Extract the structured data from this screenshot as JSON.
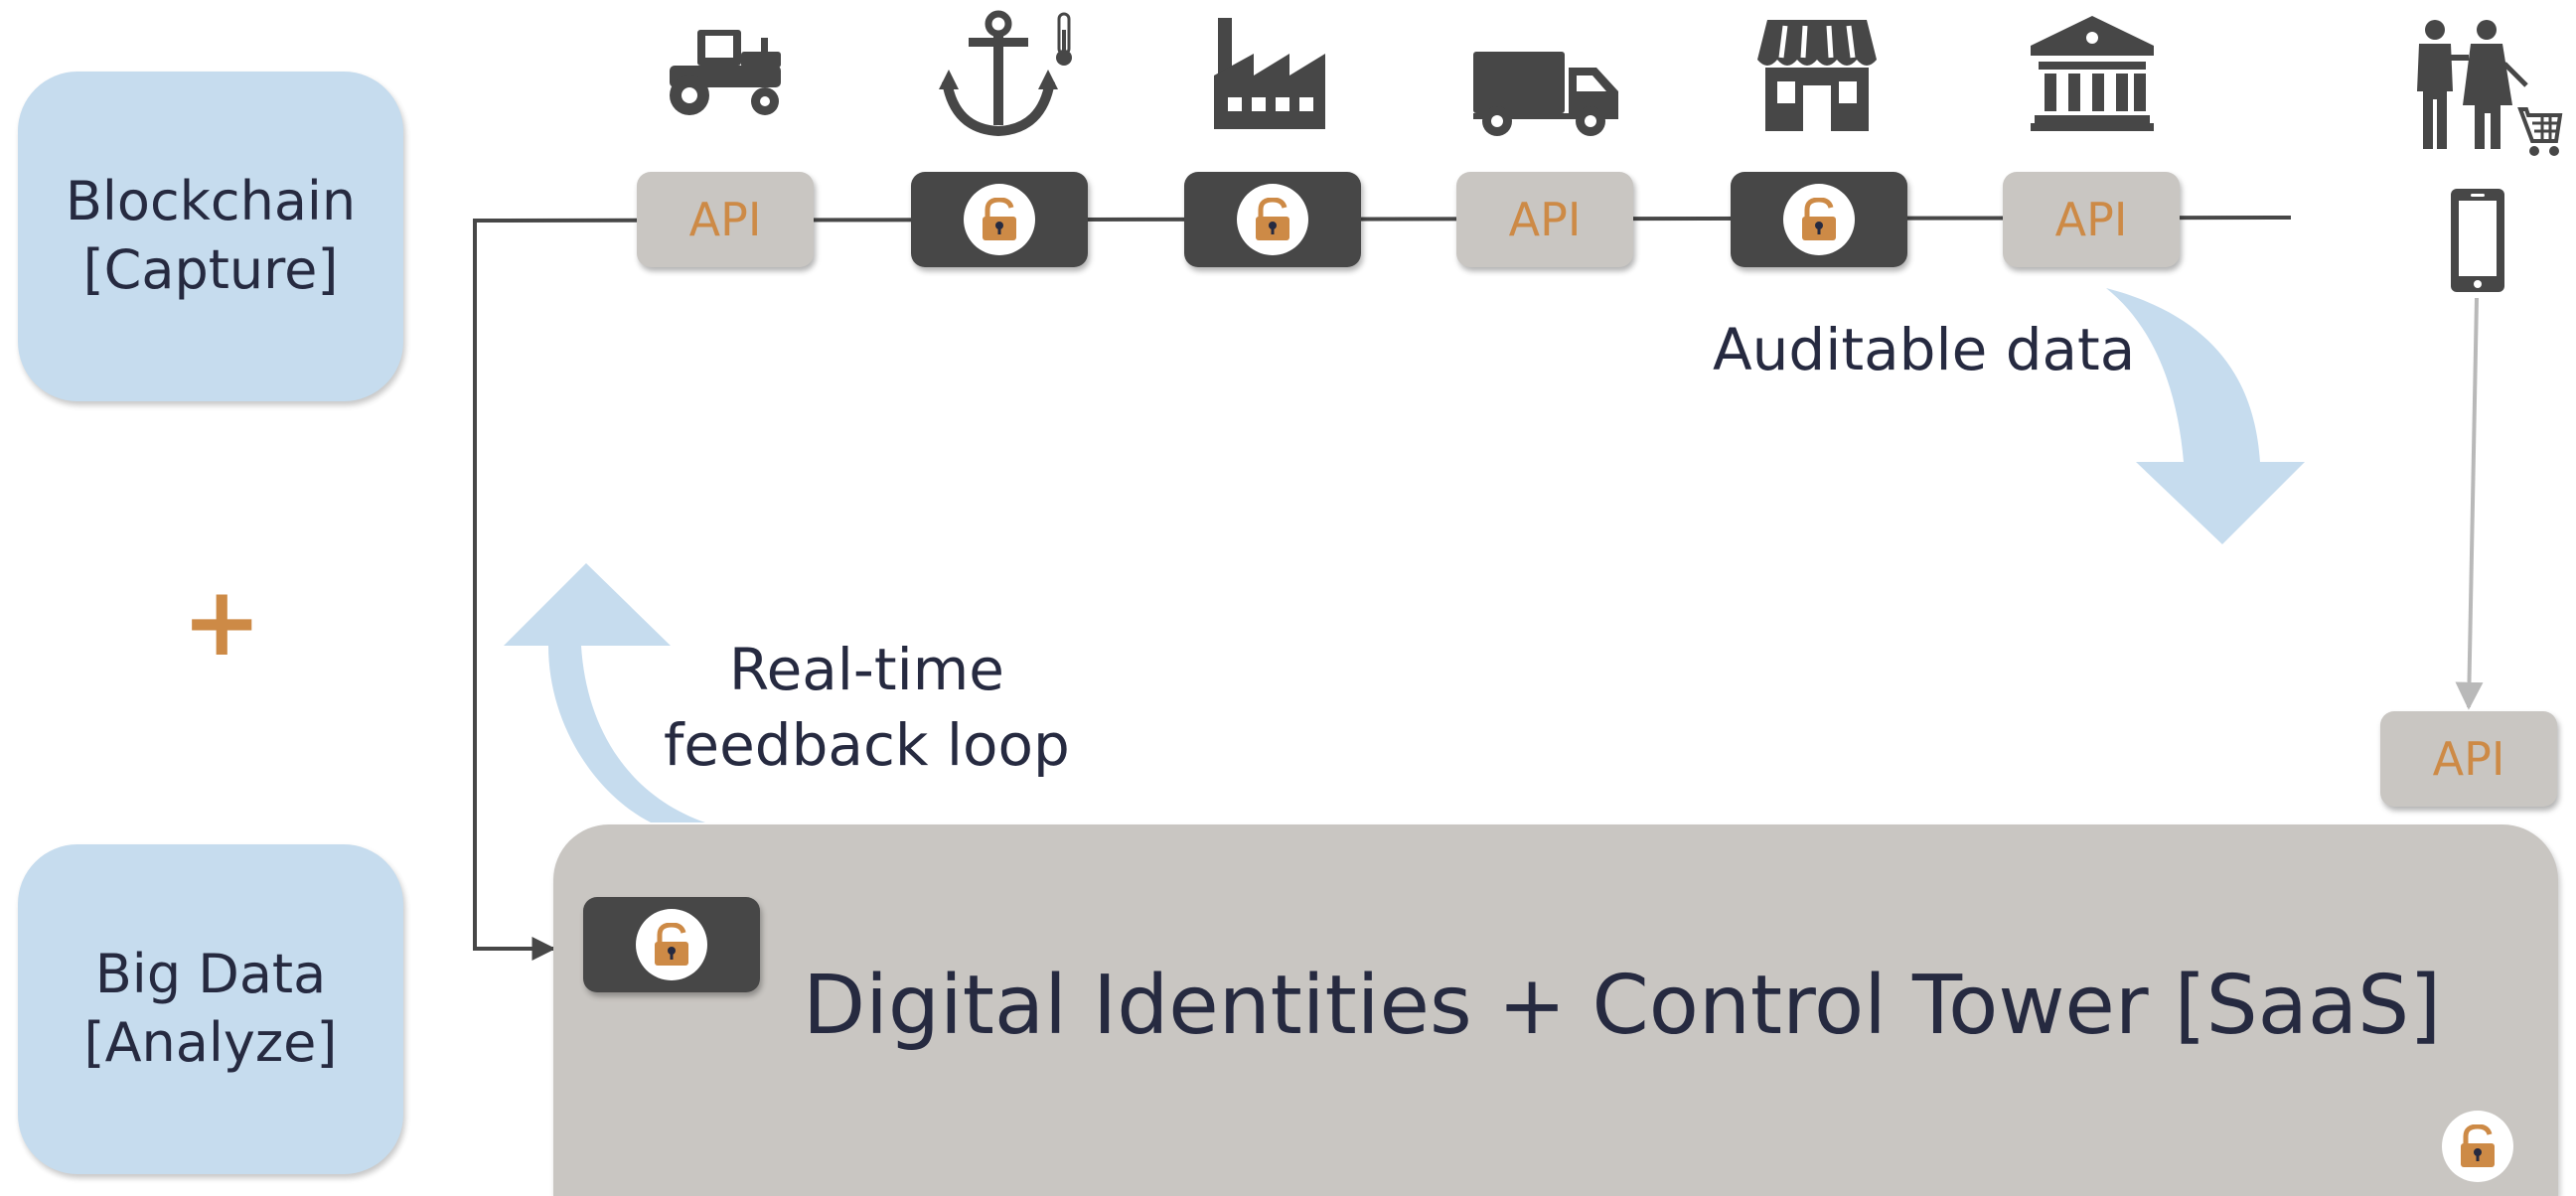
{
  "colors": {
    "side_box": "#c6dcee",
    "api_box": "#c9c6c2",
    "lock_box": "#474747",
    "accent": "#cd8a46",
    "text": "#262a40",
    "arrow": "#c6dcee",
    "icon": "#474747"
  },
  "side": {
    "blockchain": {
      "line1": "Blockchain",
      "line2": "[Capture]"
    },
    "plus": "+",
    "bigdata": {
      "line1": "Big Data",
      "line2": "[Analyze]"
    }
  },
  "chain": {
    "nodes": [
      {
        "kind": "api",
        "label": "API",
        "icon": "tractor-icon"
      },
      {
        "kind": "lock",
        "icon": "anchor-thermometer-icon"
      },
      {
        "kind": "lock",
        "icon": "factory-icon"
      },
      {
        "kind": "api",
        "label": "API",
        "icon": "truck-icon"
      },
      {
        "kind": "lock",
        "icon": "store-icon"
      },
      {
        "kind": "api",
        "label": "API",
        "icon": "bank-icon"
      }
    ],
    "consumer_icons": [
      "shoppers-cart-icon",
      "smartphone-icon"
    ],
    "consumer_api": "API"
  },
  "labels": {
    "auditable": "Auditable data",
    "feedback_line1": "Real-time",
    "feedback_line2": "feedback loop"
  },
  "platform": {
    "title": "Digital Identities + Control Tower [SaaS]"
  }
}
